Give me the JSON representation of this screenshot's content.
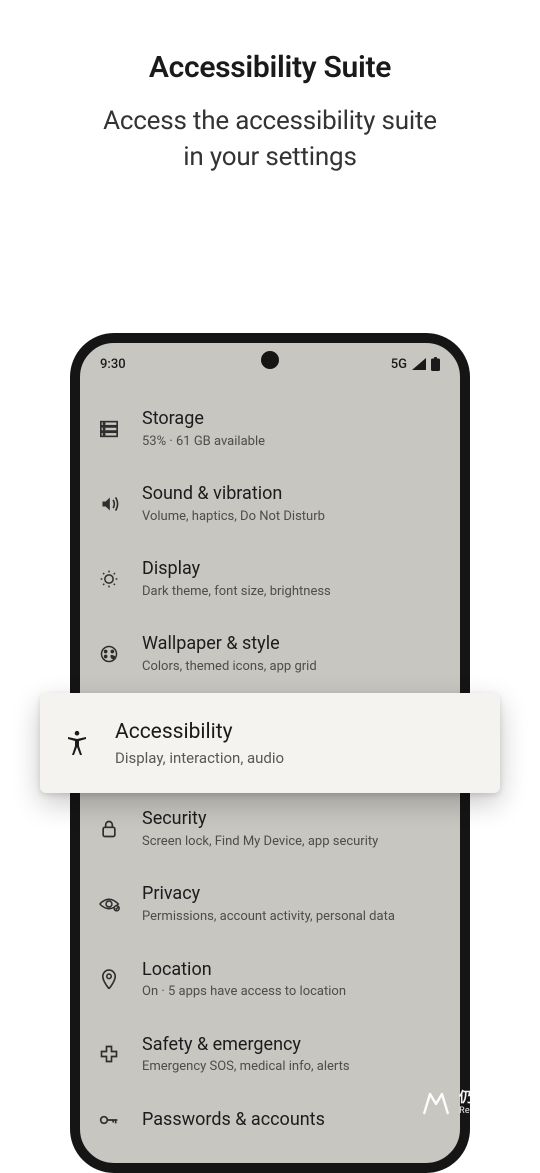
{
  "hero": {
    "title": "Accessibility Suite",
    "subtitle_l1": "Access the accessibility suite",
    "subtitle_l2": "in your settings"
  },
  "status": {
    "time": "9:30",
    "network": "5G"
  },
  "items": [
    {
      "icon": "storage-icon",
      "title": "Storage",
      "sub": "53% · 61 GB available"
    },
    {
      "icon": "sound-icon",
      "title": "Sound & vibration",
      "sub": "Volume, haptics, Do Not Disturb"
    },
    {
      "icon": "display-icon",
      "title": "Display",
      "sub": "Dark theme, font size, brightness"
    },
    {
      "icon": "wallpaper-icon",
      "title": "Wallpaper & style",
      "sub": "Colors, themed icons, app grid"
    },
    {
      "icon": "security-icon",
      "title": "Security",
      "sub": "Screen lock, Find My Device, app security"
    },
    {
      "icon": "privacy-icon",
      "title": "Privacy",
      "sub": "Permissions, account activity, personal data"
    },
    {
      "icon": "location-icon",
      "title": "Location",
      "sub": "On · 5 apps have access to location"
    },
    {
      "icon": "safety-icon",
      "title": "Safety & emergency",
      "sub": "Emergency SOS, medical info, alerts"
    },
    {
      "icon": "passwords-icon",
      "title": "Passwords & accounts",
      "sub": ""
    }
  ],
  "highlight": {
    "title": "Accessibility",
    "sub": "Display, interaction, audio"
  },
  "watermark": {
    "zh": "仍玩游戏",
    "en": "RengwanGames"
  }
}
